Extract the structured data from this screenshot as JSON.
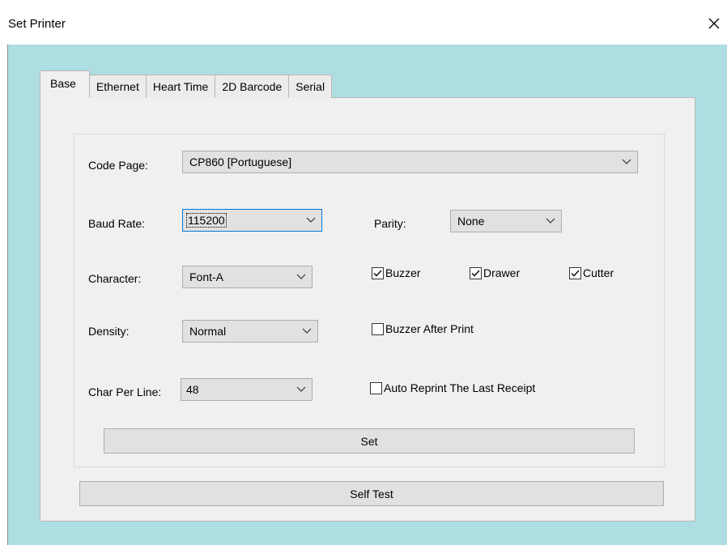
{
  "window": {
    "title": "Set Printer"
  },
  "tabs": [
    {
      "label": "Base",
      "active": true
    },
    {
      "label": "Ethernet",
      "active": false
    },
    {
      "label": "Heart Time",
      "active": false
    },
    {
      "label": "2D Barcode",
      "active": false
    },
    {
      "label": "Serial",
      "active": false
    }
  ],
  "form": {
    "code_page": {
      "label": "Code Page:",
      "value": "CP860 [Portuguese]"
    },
    "baud_rate": {
      "label": "Baud Rate:",
      "value": "115200"
    },
    "parity": {
      "label": "Parity:",
      "value": "None"
    },
    "character": {
      "label": "Character:",
      "value": "Font-A"
    },
    "density": {
      "label": "Density:",
      "value": "Normal"
    },
    "char_per_line": {
      "label": "Char Per Line:",
      "value": "48"
    },
    "buzzer": {
      "label": "Buzzer",
      "checked": true
    },
    "drawer": {
      "label": "Drawer",
      "checked": true
    },
    "cutter": {
      "label": "Cutter",
      "checked": true
    },
    "buzzer_after_print": {
      "label": "Buzzer After Print",
      "checked": false
    },
    "auto_reprint": {
      "label": "Auto Reprint The Last Receipt",
      "checked": false
    }
  },
  "buttons": {
    "set": "Set",
    "self_test": "Self Test"
  },
  "icons": {
    "close": "close-icon",
    "dropdown": "chevron-down-icon",
    "check": "checkmark-icon"
  },
  "colors": {
    "client_background": "#aedde2",
    "panel_background": "#f0f0f0",
    "button_background": "#e1e1e1"
  }
}
